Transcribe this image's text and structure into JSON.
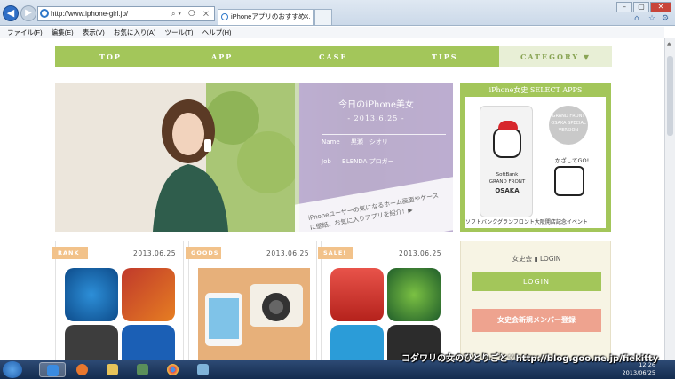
{
  "browser": {
    "address": "http://www.iphone-girl.jp/",
    "tab_title": "iPhoneアプリのおすすめ...",
    "menu": [
      "ファイル(F)",
      "編集(E)",
      "表示(V)",
      "お気に入り(A)",
      "ツール(T)",
      "ヘルプ(H)"
    ]
  },
  "site": {
    "nav": [
      "TOP",
      "APP",
      "CASE",
      "TIPS",
      "CATEGORY ▼"
    ],
    "hero": {
      "title": "今日のiPhone美女",
      "date": "- 2013.6.25 -",
      "name_label": "Name",
      "name": "黒瀬　シオリ",
      "job_label": "Job",
      "job": "BLENDA プロガー",
      "banner": "iPhoneユーザーの気になるホーム画面やケースに壁紙、お気に入りアプリを紹介！▶"
    },
    "select_apps": {
      "heading": "iPhone女史 SELECT APPS",
      "phone_text1": "SoftBank",
      "phone_text2": "GRAND FRONT",
      "phone_text3": "OSAKA",
      "badge": "GRAND FRONT OSAKA SPECIAL VERSION",
      "kazashi": "かざしてGO!",
      "caption": "ソフトバンクグランフロント大阪開店記念イベント"
    },
    "cards": [
      {
        "tag": "RANK",
        "date": "2013.06.25"
      },
      {
        "tag": "GOODS",
        "date": "2013.06.25"
      },
      {
        "tag": "SALE!",
        "date": "2013.06.25"
      }
    ],
    "login": {
      "heading": "女史会 ▮ LOGIN",
      "login_button": "LOGIN",
      "register_button": "女史会新規メンバー登録"
    }
  },
  "watermark": "コダワリの女のひとりごと♡http://blog.goo.ne.jp/fiekitty",
  "clock": {
    "time": "12:26",
    "date": "2013/06/25"
  },
  "colors": {
    "accent_green": "#a3c65a",
    "hero_purple": "#baa6d6",
    "tag_orange": "#f2c28a",
    "register_pink": "#eea38f"
  }
}
